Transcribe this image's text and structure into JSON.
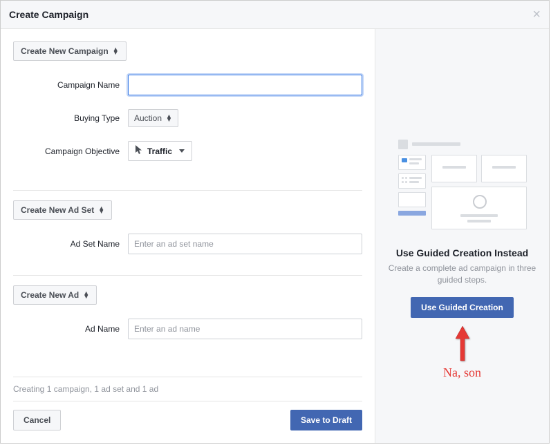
{
  "header": {
    "title": "Create Campaign"
  },
  "campaign": {
    "dropdown_label": "Create New Campaign",
    "name_label": "Campaign Name",
    "name_value": "",
    "buying_label": "Buying Type",
    "buying_value": "Auction",
    "objective_label": "Campaign Objective",
    "objective_value": "Traffic"
  },
  "adset": {
    "dropdown_label": "Create New Ad Set",
    "name_label": "Ad Set Name",
    "name_placeholder": "Enter an ad set name",
    "name_value": ""
  },
  "ad": {
    "dropdown_label": "Create New Ad",
    "name_label": "Ad Name",
    "name_placeholder": "Enter an ad name",
    "name_value": ""
  },
  "footer": {
    "info": "Creating 1 campaign, 1 ad set and 1 ad",
    "cancel": "Cancel",
    "save": "Save to Draft"
  },
  "side": {
    "title": "Use Guided Creation Instead",
    "desc": "Create a complete ad campaign in three guided steps.",
    "button": "Use Guided Creation"
  },
  "annotation": {
    "text": "Na, son"
  }
}
